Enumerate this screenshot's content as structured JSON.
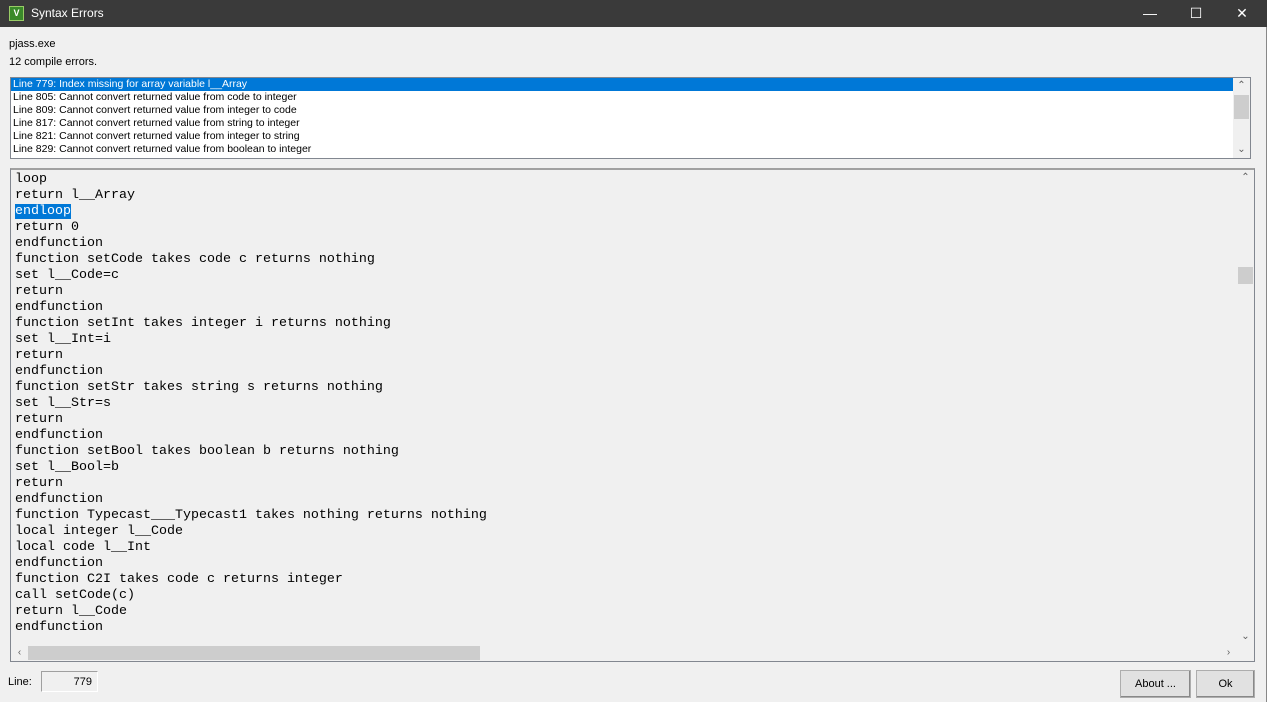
{
  "window": {
    "title": "Syntax Errors",
    "icon": "vjass-app-icon",
    "minimize": "—",
    "maximize": "☐",
    "close": "✕"
  },
  "program": "pjass.exe",
  "summary": "12 compile errors.",
  "errors": [
    "Line 779:  Index missing for array variable l__Array",
    "Line 805:  Cannot convert returned value from code to integer",
    "Line 809:  Cannot convert returned value from integer to code",
    "Line 817:  Cannot convert returned value from string to integer",
    "Line 821:  Cannot convert returned value from integer to string",
    "Line 829:  Cannot convert returned value from boolean to integer"
  ],
  "selected_error": 0,
  "code_lines": [
    "loop",
    "return l__Array",
    "endloop",
    "return 0",
    "endfunction",
    "function setCode takes code c returns nothing",
    "set l__Code=c",
    "return",
    "endfunction",
    "function setInt takes integer i returns nothing",
    "set l__Int=i",
    "return",
    "endfunction",
    "function setStr takes string s returns nothing",
    "set l__Str=s",
    "return",
    "endfunction",
    "function setBool takes boolean b returns nothing",
    "set l__Bool=b",
    "return",
    "endfunction",
    "function Typecast___Typecast1 takes nothing returns nothing",
    "local integer l__Code",
    "local code l__Int",
    "endfunction",
    "function C2I takes code c returns integer",
    "call setCode(c)",
    "return l__Code",
    "endfunction"
  ],
  "highlighted_line": 2,
  "footer": {
    "line_label": "Line:",
    "line_value": "779",
    "about_label": "About ...",
    "ok_label": "Ok"
  }
}
